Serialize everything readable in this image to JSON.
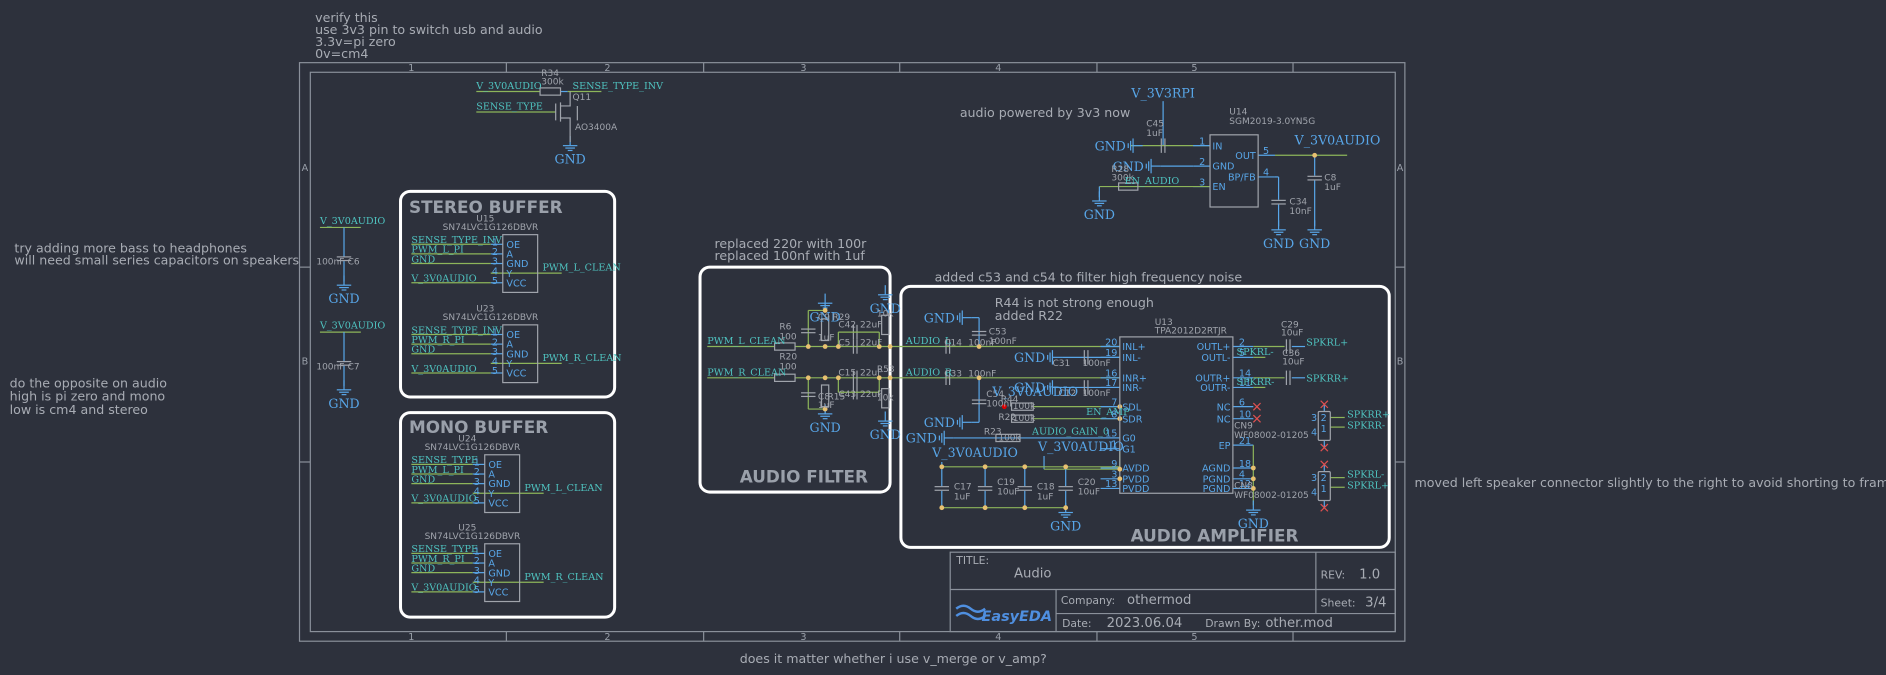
{
  "notes": {
    "verify": [
      "verify this",
      "use 3v3 pin to switch usb and audio",
      "3.3v=pi zero",
      "0v=cm4"
    ],
    "bass": [
      "try adding more bass to headphones",
      "will need small series capacitors on speakers"
    ],
    "opposite": [
      "do the opposite on audio",
      "high is pi zero and mono",
      "low is cm4 and stereo"
    ],
    "power": "audio powered by 3v3 now",
    "filter": [
      "replaced 220r with 100r",
      "replaced 100nf with 1uf"
    ],
    "noise": "added c53 and c54 to filter high frequency noise",
    "r44": [
      "R44 is not strong enough",
      "added R22"
    ],
    "speaker": "moved left speaker connector slightly to the right to avoid shorting to frame",
    "vmerge": "does it matter whether i use v_merge or v_amp?"
  },
  "frame": {
    "cols": [
      "1",
      "2",
      "3",
      "4",
      "5"
    ],
    "rows": [
      "A",
      "B"
    ]
  },
  "blocks": {
    "stereo": "STEREO BUFFER",
    "mono": "MONO BUFFER",
    "filter": "AUDIO FILTER",
    "amp": "AUDIO AMPLIFIER"
  },
  "buffer_pins": {
    "names": [
      "OE",
      "A",
      "GND",
      "Y",
      "VCC"
    ],
    "numbers": [
      "1",
      "2",
      "3",
      "4",
      "5"
    ]
  },
  "buffers": [
    {
      "ref": "U15",
      "part": "SN74LVC1G126DBVR",
      "nets": [
        "SENSE_TYPE_INV",
        "PWM_L_PI",
        "GND",
        "V_3V0AUDIO"
      ],
      "out": "PWM_L_CLEAN"
    },
    {
      "ref": "U23",
      "part": "SN74LVC1G126DBVR",
      "nets": [
        "SENSE_TYPE_INV",
        "PWM_R_PI",
        "GND",
        "V_3V0AUDIO"
      ],
      "out": "PWM_R_CLEAN"
    },
    {
      "ref": "U24",
      "part": "SN74LVC1G126DBVR",
      "nets": [
        "SENSE_TYPE",
        "PWM_L_PI",
        "GND",
        "V_3V0AUDIO"
      ],
      "out": "PWM_L_CLEAN"
    },
    {
      "ref": "U25",
      "part": "SN74LVC1G126DBVR",
      "nets": [
        "SENSE_TYPE",
        "PWM_R_PI",
        "GND",
        "V_3V0AUDIO"
      ],
      "out": "PWM_R_CLEAN"
    }
  ],
  "gnd": "GND",
  "decoupling": [
    {
      "net": "V_3V0AUDIO",
      "ref": "C6",
      "value": "100nF"
    },
    {
      "net": "V_3V0AUDIO",
      "ref": "C7",
      "value": "100nF"
    }
  ],
  "sense": {
    "supply": "V_3V0AUDIO",
    "r_ref": "R34",
    "r_val": "300k",
    "out_net": "SENSE_TYPE_INV",
    "q_ref": "Q11",
    "q_part": "AO3400A",
    "gate_net": "SENSE_TYPE"
  },
  "ldo": {
    "vin": "V_3V3RPI",
    "c_in_ref": "C45",
    "c_in_val": "1uF",
    "ref": "U14",
    "part": "SGM2019-3.0YN5G",
    "pins": [
      {
        "num": "1",
        "name": "IN"
      },
      {
        "num": "2",
        "name": "GND"
      },
      {
        "num": "3",
        "name": "EN"
      },
      {
        "num": "5",
        "name": "OUT"
      },
      {
        "num": "4",
        "name": "BP/FB"
      }
    ],
    "r_ref": "R28",
    "r_val": "300k",
    "en_net": "EN_AUDIO",
    "c_bp_ref": "C34",
    "c_bp_val": "10nF",
    "vout": "V_3V0AUDIO",
    "c_out_ref": "C8",
    "c_out_val": "1uF"
  },
  "filter": {
    "in_l": "PWM_L_CLEAN",
    "in_r": "PWM_R_CLEAN",
    "r_l_ref": "R6",
    "r_l_val": "100",
    "r_r_ref": "R20",
    "r_r_val": "100",
    "c_l_ref": "C9",
    "c_l_val": "1uF",
    "c_r_ref": "C8",
    "c_r_val": "1uF",
    "r29": "R29",
    "r15": "R15",
    "c42": "C42",
    "c5": "C5",
    "c15": "C15",
    "c43": "C43",
    "cap_val": "22uF",
    "r_out_l": "10k",
    "r53": "R53",
    "r_out_r": "10k"
  },
  "amp": {
    "c53_ref": "C53",
    "c53_val": "100nF",
    "c14_ref": "C14",
    "c14_val": "100nF",
    "c31_ref": "C31",
    "c31_val": "100nF",
    "c33_ref": "C33",
    "c33_val": "100nF",
    "c12_ref": "C12",
    "c12_val": "100nF",
    "c54_ref": "C54",
    "c54_val": "100nF",
    "audio_l": "AUDIO_L",
    "audio_r": "AUDIO_R",
    "r44_ref": "R44",
    "r22_ref": "R22",
    "r_val": "100k",
    "en_amp": "EN_AMP",
    "r23_ref": "R23",
    "gain_net": "AUDIO_GAIN_0",
    "supply": "V_3V0AUDIO",
    "ref": "U13",
    "part": "TPA2012D2RTJR",
    "left_pins": [
      {
        "num": "20",
        "name": "INL+"
      },
      {
        "num": "19",
        "name": "INL-"
      },
      {
        "num": "16",
        "name": "INR+"
      },
      {
        "num": "17",
        "name": "INR-"
      },
      {
        "num": "7",
        "name": "SDL"
      },
      {
        "num": "8",
        "name": "SDR"
      },
      {
        "num": "15",
        "name": "G0"
      },
      {
        "num": "1",
        "name": "G1"
      },
      {
        "num": "9",
        "name": "AVDD"
      },
      {
        "num": "3",
        "name": "PVDD"
      },
      {
        "num": "13",
        "name": "PVDD"
      }
    ],
    "right_pins": [
      {
        "num": "2",
        "name": "OUTL+"
      },
      {
        "num": "5",
        "name": "OUTL-"
      },
      {
        "num": "14",
        "name": "OUTR+"
      },
      {
        "num": "11",
        "name": "OUTR-"
      },
      {
        "num": "6",
        "name": "NC"
      },
      {
        "num": "10",
        "name": "NC"
      },
      {
        "num": "21",
        "name": "EP"
      },
      {
        "num": "18",
        "name": "AGND"
      },
      {
        "num": "4",
        "name": "PGND"
      },
      {
        "num": "12",
        "name": "PGND"
      }
    ],
    "spk": {
      "lp": "SPKRL+",
      "lm": "SPKRL-",
      "rp": "SPKRR+",
      "rm": "SPKRR-"
    },
    "c29_ref": "C29",
    "c29_val": "10uF",
    "c36_ref": "C36",
    "c36_val": "10uF",
    "bulk": [
      {
        "ref": "C17",
        "value": "1uF"
      },
      {
        "ref": "C19",
        "value": "10uF"
      },
      {
        "ref": "C18",
        "value": "1uF"
      },
      {
        "ref": "C20",
        "value": "10uF"
      }
    ],
    "connectors": [
      {
        "ref": "CN9",
        "part": "WF08002-01205",
        "net1": "SPKRR+",
        "net2": "SPKRR-"
      },
      {
        "ref": "CN8",
        "part": "WF08002-01205",
        "net1": "SPKRL-",
        "net2": "SPKRL+"
      }
    ],
    "conn_pins": [
      "1",
      "2",
      "3",
      "4"
    ]
  },
  "title_block": {
    "title_label": "TITLE:",
    "title": "Audio",
    "rev_label": "REV:",
    "rev": "1.0",
    "company_label": "Company:",
    "company": "othermod",
    "sheet_label": "Sheet:",
    "sheet": "3/4",
    "date_label": "Date:",
    "date": "2023.06.04",
    "drawn_label": "Drawn By:",
    "drawn": "other.mod",
    "logo": "EasyEDA"
  },
  "colors": {
    "background": "#2d313c",
    "wire": "#8db55a",
    "pin": "#58a6e8",
    "net": "#4fc3c0",
    "junction": "#e8c070",
    "block": "#ffffff"
  }
}
